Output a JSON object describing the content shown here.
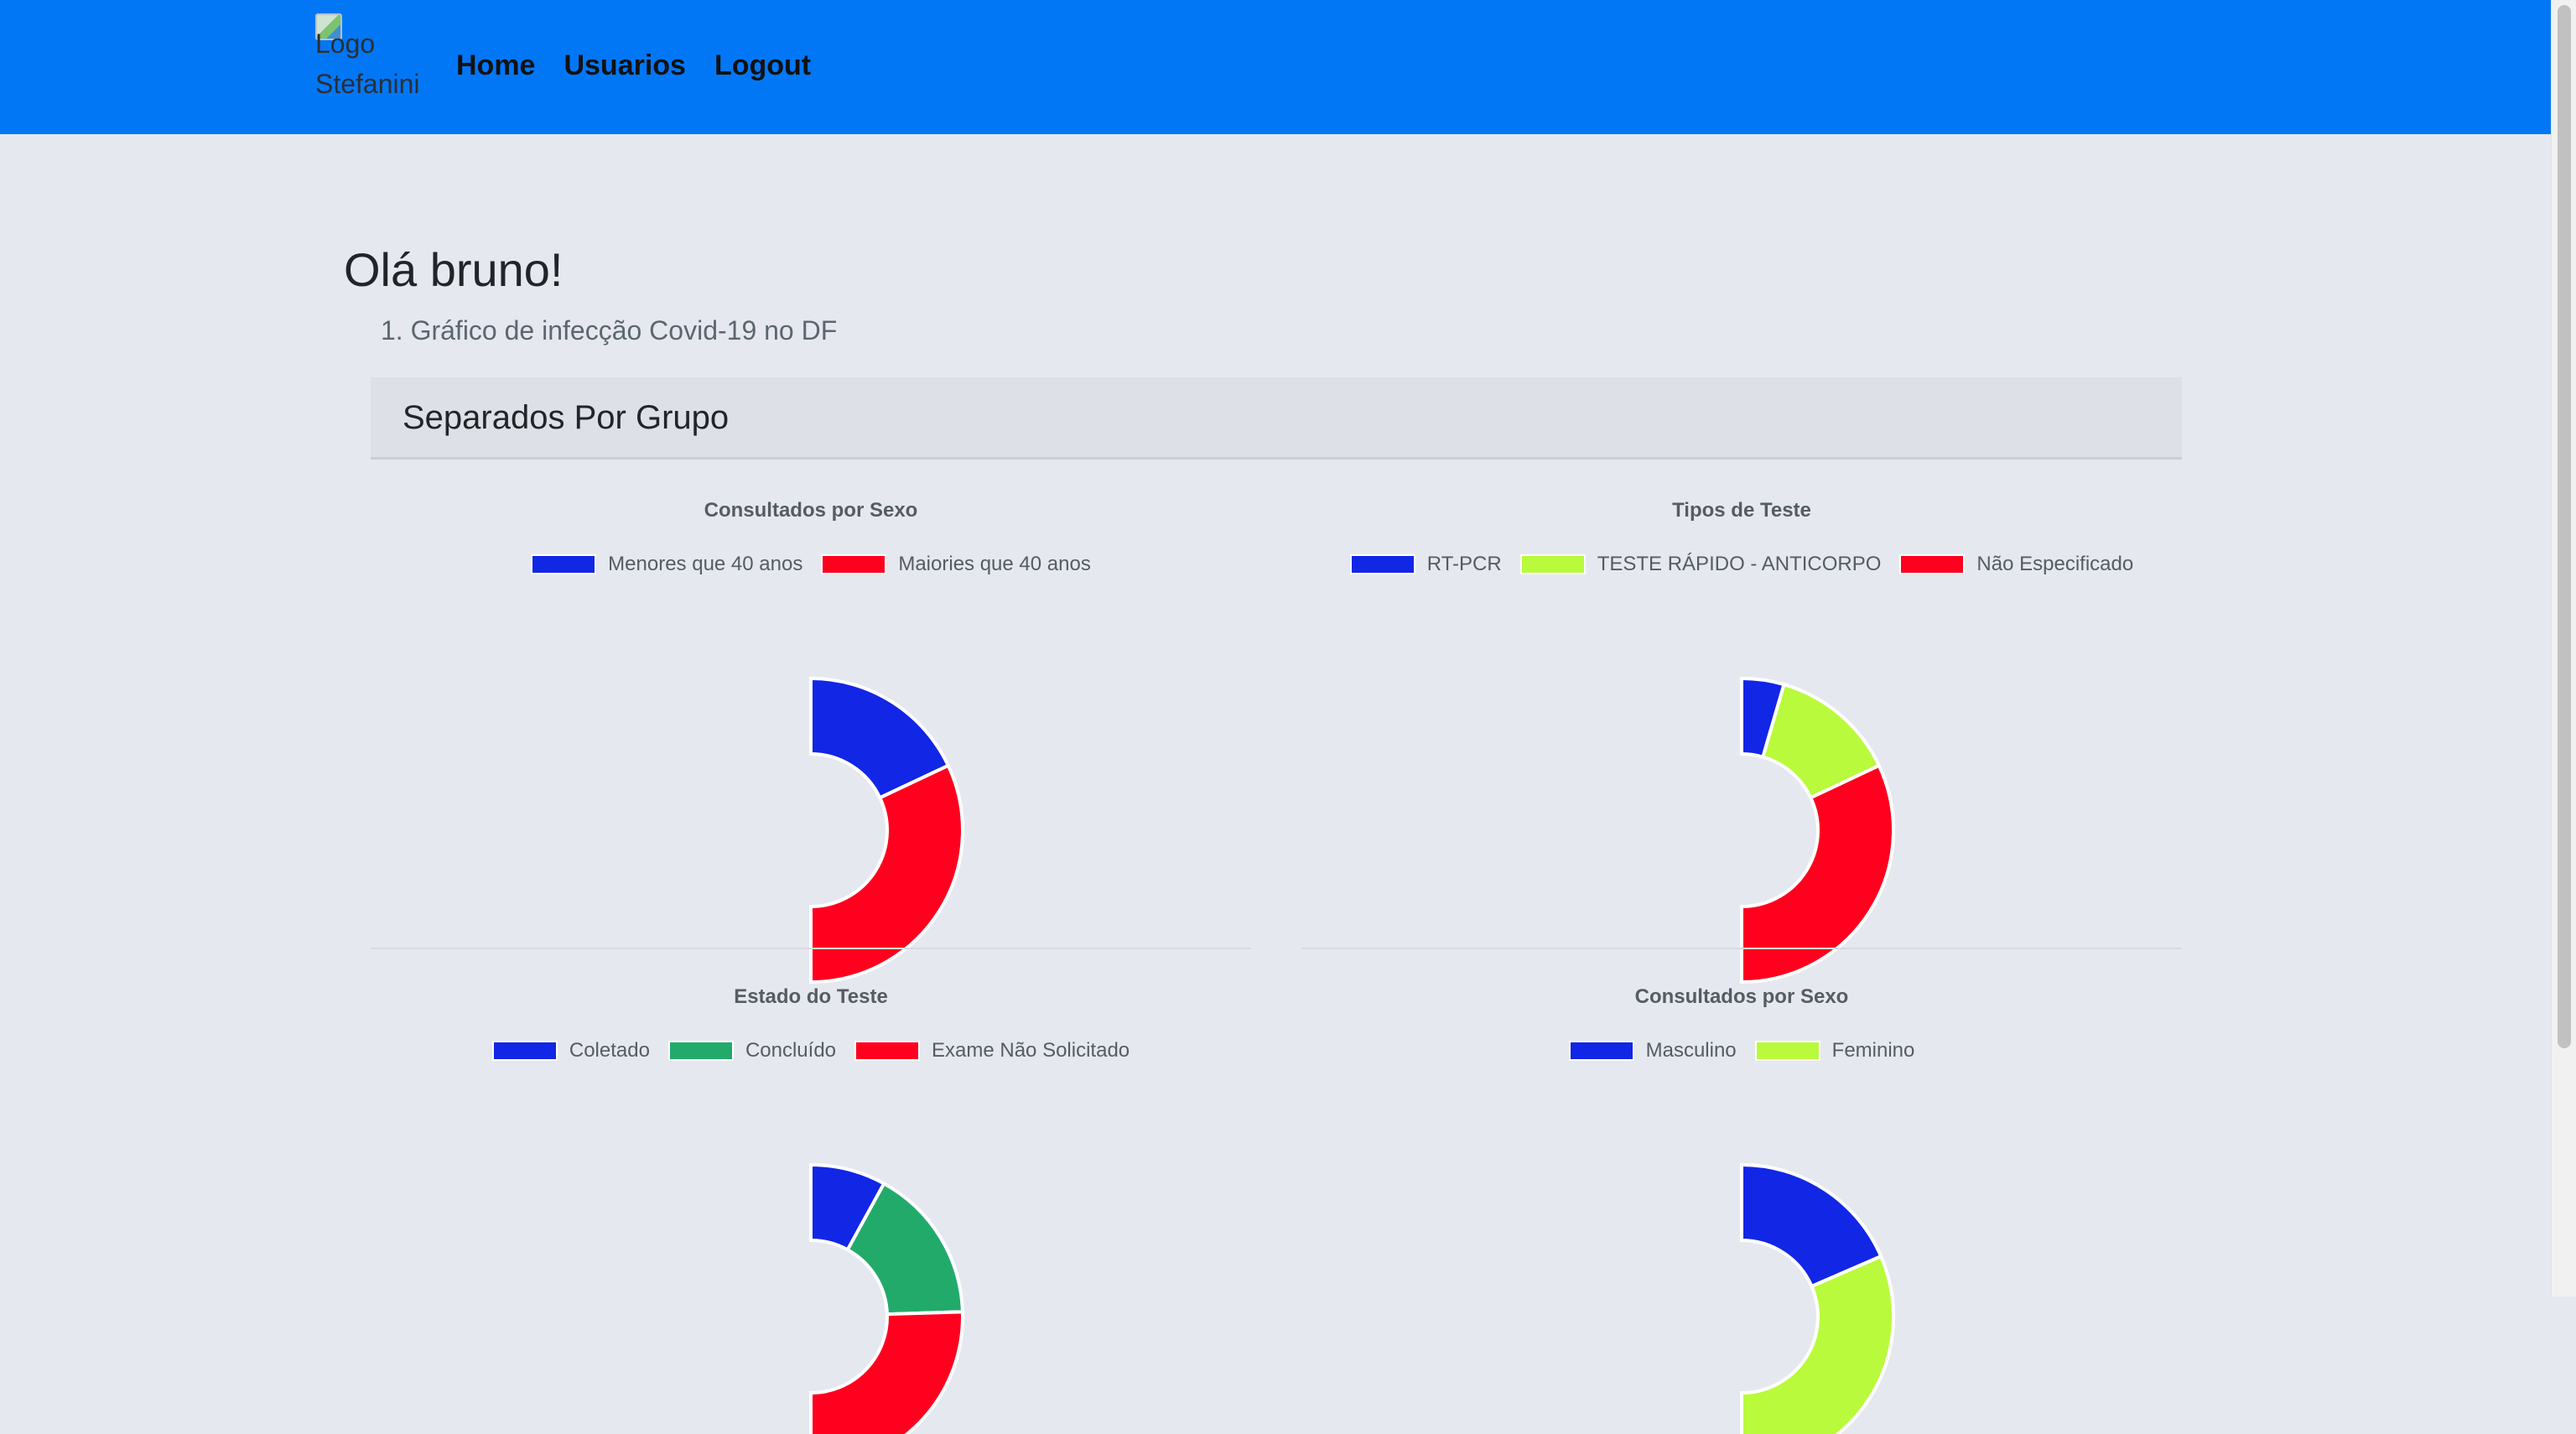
{
  "nav": {
    "logo_alt": "Logo Stefanini",
    "links": [
      "Home",
      "Usuarios",
      "Logout"
    ]
  },
  "greeting": "Olá bruno!",
  "list_item": "1. Gráfico de infecção Covid-19 no DF",
  "card": {
    "title": "Separados Por Grupo"
  },
  "colors": {
    "navbar": "#0277f6",
    "blue": "#1226e6",
    "lime": "#b9fa3c",
    "red": "#ff001e",
    "green": "#22aa6b"
  },
  "chart_data": [
    {
      "type": "doughnut",
      "title": "Consultados por Sexo",
      "series": [
        {
          "name": "Menores que 40 anos",
          "value": 36,
          "color": "#1226e6"
        },
        {
          "name": "Maiories que 40 anos",
          "value": 64,
          "color": "#ff001e"
        }
      ]
    },
    {
      "type": "doughnut",
      "title": "Tipos de Teste",
      "series": [
        {
          "name": "RT-PCR",
          "value": 9,
          "color": "#1226e6"
        },
        {
          "name": "TESTE RÁPIDO - ANTICORPO",
          "value": 27,
          "color": "#b9fa3c"
        },
        {
          "name": "Não Especificado",
          "value": 64,
          "color": "#ff001e"
        }
      ]
    },
    {
      "type": "doughnut",
      "title": "Estado do Teste",
      "series": [
        {
          "name": "Coletado",
          "value": 16,
          "color": "#1226e6"
        },
        {
          "name": "Concluído",
          "value": 33,
          "color": "#22aa6b"
        },
        {
          "name": "Exame Não Solicitado",
          "value": 51,
          "color": "#ff001e"
        }
      ]
    },
    {
      "type": "doughnut",
      "title": "Consultados por Sexo",
      "series": [
        {
          "name": "Masculino",
          "value": 37,
          "color": "#1226e6"
        },
        {
          "name": "Feminino",
          "value": 63,
          "color": "#b9fa3c"
        }
      ]
    }
  ]
}
